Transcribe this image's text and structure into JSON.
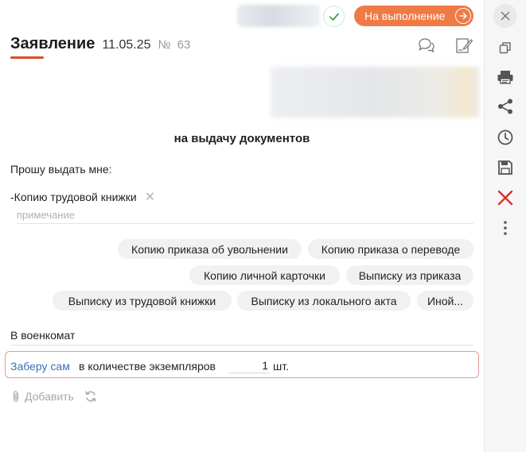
{
  "topbar": {
    "status_label": "На выполнение",
    "status_color": "#ef7a46",
    "approve_icon": "check-icon",
    "arrow_icon": "arrow-right-icon"
  },
  "header": {
    "title": "Заявление",
    "date": "11.05.25",
    "number_sign": "№",
    "number": "63",
    "comments_icon": "comments-icon",
    "sign_icon": "sign-document-icon",
    "accent_color": "#d64e2b"
  },
  "document": {
    "title": "на выдачу документов",
    "request_text": "Прошу выдать мне:",
    "selected_item": "Копию трудовой книжки",
    "note_placeholder": "примечание",
    "options": [
      "Копию приказа об увольнении",
      "Копию приказа о переводе",
      "Копию личной карточки",
      "Выписку из приказа",
      "Выписку из трудовой книжки",
      "Выписку из локального акта",
      "Иной..."
    ],
    "destination": "В военкомат",
    "pickup_link": "Заберу сам",
    "copies_text": "в количестве экземпляров",
    "copies_value": "1",
    "copies_unit": "шт."
  },
  "footer": {
    "add_label": "Добавить",
    "attach_icon": "paperclip-icon",
    "refresh_icon": "refresh-icon"
  },
  "sidebar": {
    "icons": [
      "close-icon",
      "copy-icon",
      "print-icon",
      "share-icon",
      "history-icon",
      "save-icon",
      "delete-icon",
      "more-vertical-icon"
    ],
    "delete_color": "#d9322b"
  }
}
